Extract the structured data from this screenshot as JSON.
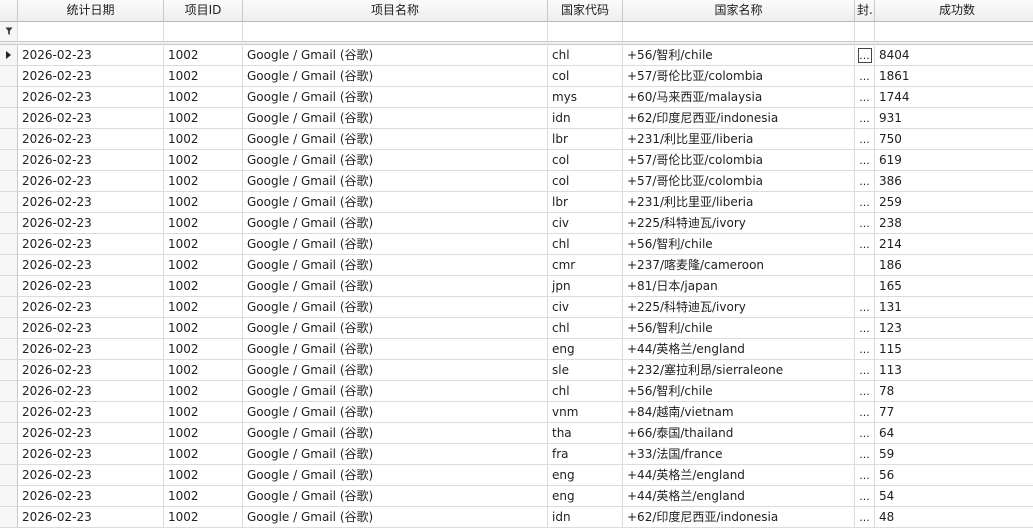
{
  "columns": [
    "统计日期",
    "项目ID",
    "项目名称",
    "国家代码",
    "国家名称",
    "封...",
    "成功数"
  ],
  "filter_icon": "filter-icon",
  "row_indicator_icon": "current-row-arrow-icon",
  "ellipsis_text": "...",
  "rows": [
    [
      "2026-02-23",
      "1002",
      "Google / Gmail (谷歌)",
      "chl",
      "+56/智利/chile",
      "...",
      "8404"
    ],
    [
      "2026-02-23",
      "1002",
      "Google / Gmail (谷歌)",
      "col",
      "+57/哥伦比亚/colombia",
      "...",
      "1861"
    ],
    [
      "2026-02-23",
      "1002",
      "Google / Gmail (谷歌)",
      "mys",
      "+60/马来西亚/malaysia",
      "...",
      "1744"
    ],
    [
      "2026-02-23",
      "1002",
      "Google / Gmail (谷歌)",
      "idn",
      "+62/印度尼西亚/indonesia",
      "...",
      "931"
    ],
    [
      "2026-02-23",
      "1002",
      "Google / Gmail (谷歌)",
      "lbr",
      "+231/利比里亚/liberia",
      "...",
      "750"
    ],
    [
      "2026-02-23",
      "1002",
      "Google / Gmail (谷歌)",
      "col",
      "+57/哥伦比亚/colombia",
      "...",
      "619"
    ],
    [
      "2026-02-23",
      "1002",
      "Google / Gmail (谷歌)",
      "col",
      "+57/哥伦比亚/colombia",
      "...",
      "386"
    ],
    [
      "2026-02-23",
      "1002",
      "Google / Gmail (谷歌)",
      "lbr",
      "+231/利比里亚/liberia",
      "...",
      "259"
    ],
    [
      "2026-02-23",
      "1002",
      "Google / Gmail (谷歌)",
      "civ",
      "+225/科特迪瓦/ivory",
      "...",
      "238"
    ],
    [
      "2026-02-23",
      "1002",
      "Google / Gmail (谷歌)",
      "chl",
      "+56/智利/chile",
      "...",
      "214"
    ],
    [
      "2026-02-23",
      "1002",
      "Google / Gmail (谷歌)",
      "cmr",
      "+237/喀麦隆/cameroon",
      "",
      "186"
    ],
    [
      "2026-02-23",
      "1002",
      "Google / Gmail (谷歌)",
      "jpn",
      "+81/日本/japan",
      "",
      "165"
    ],
    [
      "2026-02-23",
      "1002",
      "Google / Gmail (谷歌)",
      "civ",
      "+225/科特迪瓦/ivory",
      "...",
      "131"
    ],
    [
      "2026-02-23",
      "1002",
      "Google / Gmail (谷歌)",
      "chl",
      "+56/智利/chile",
      "...",
      "123"
    ],
    [
      "2026-02-23",
      "1002",
      "Google / Gmail (谷歌)",
      "eng",
      "+44/英格兰/england",
      "...",
      "115"
    ],
    [
      "2026-02-23",
      "1002",
      "Google / Gmail (谷歌)",
      "sle",
      "+232/塞拉利昂/sierraleone",
      "...",
      "113"
    ],
    [
      "2026-02-23",
      "1002",
      "Google / Gmail (谷歌)",
      "chl",
      "+56/智利/chile",
      "...",
      "78"
    ],
    [
      "2026-02-23",
      "1002",
      "Google / Gmail (谷歌)",
      "vnm",
      "+84/越南/vietnam",
      "...",
      "77"
    ],
    [
      "2026-02-23",
      "1002",
      "Google / Gmail (谷歌)",
      "tha",
      "+66/泰国/thailand",
      "...",
      "64"
    ],
    [
      "2026-02-23",
      "1002",
      "Google / Gmail (谷歌)",
      "fra",
      "+33/法国/france",
      "...",
      "59"
    ],
    [
      "2026-02-23",
      "1002",
      "Google / Gmail (谷歌)",
      "eng",
      "+44/英格兰/england",
      "...",
      "56"
    ],
    [
      "2026-02-23",
      "1002",
      "Google / Gmail (谷歌)",
      "eng",
      "+44/英格兰/england",
      "...",
      "54"
    ],
    [
      "2026-02-23",
      "1002",
      "Google / Gmail (谷歌)",
      "idn",
      "+62/印度尼西亚/indonesia",
      "...",
      "48"
    ]
  ]
}
